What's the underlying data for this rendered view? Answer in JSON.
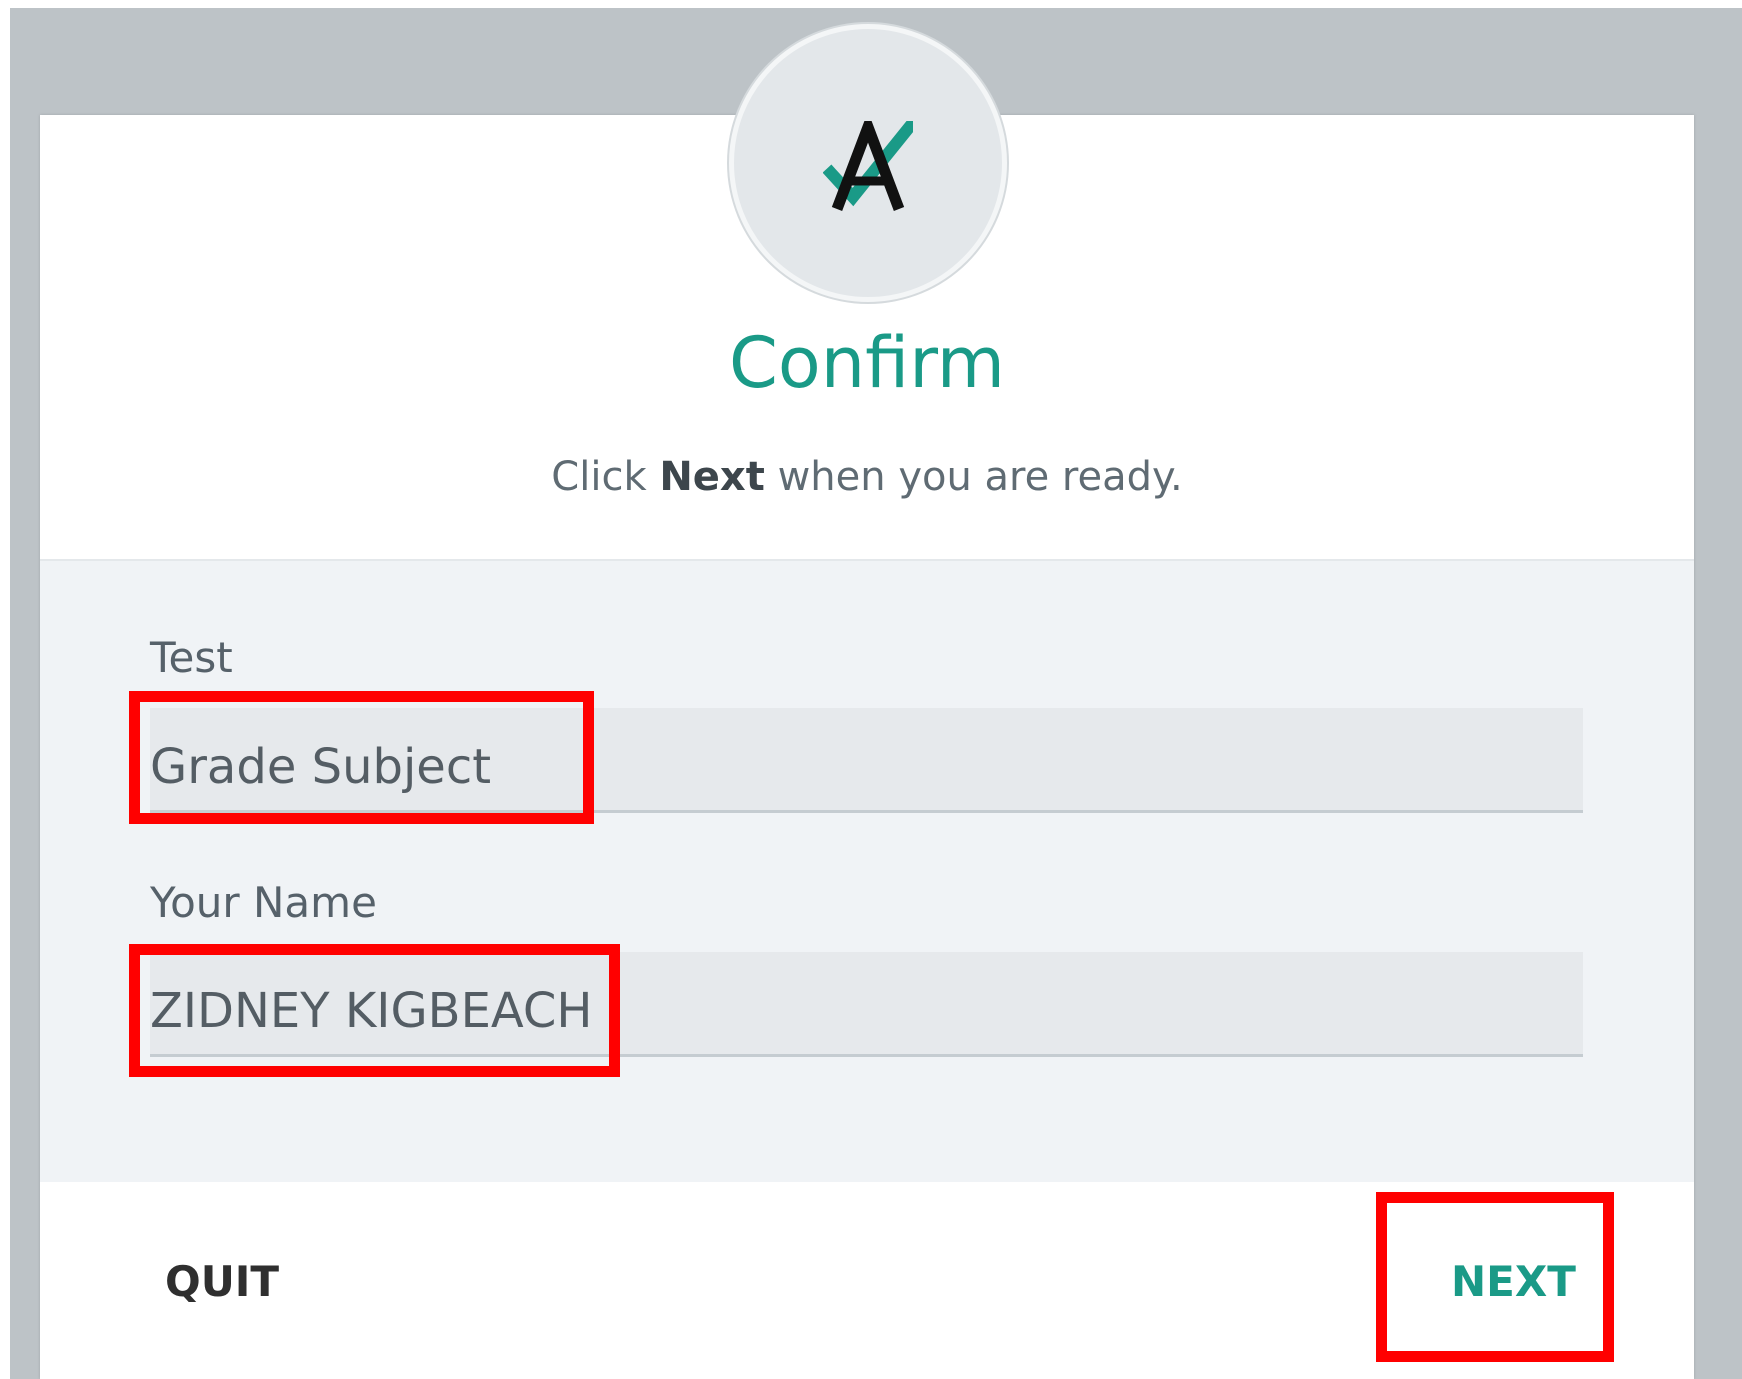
{
  "dialog": {
    "title": "Confirm",
    "subtitle_pre": "Click ",
    "subtitle_bold": "Next",
    "subtitle_post": " when you are ready."
  },
  "fields": {
    "test_label": "Test",
    "test_value": "Grade Subject",
    "name_label": "Your Name",
    "name_value": "ZIDNEY KIGBEACH"
  },
  "footer": {
    "quit_label": "QUIT",
    "next_label": "NEXT"
  },
  "colors": {
    "accent": "#1a9a87",
    "highlight": "#ff0000",
    "backdrop": "#bdc3c7"
  },
  "icons": {
    "logo": "a-check-logo-icon"
  }
}
